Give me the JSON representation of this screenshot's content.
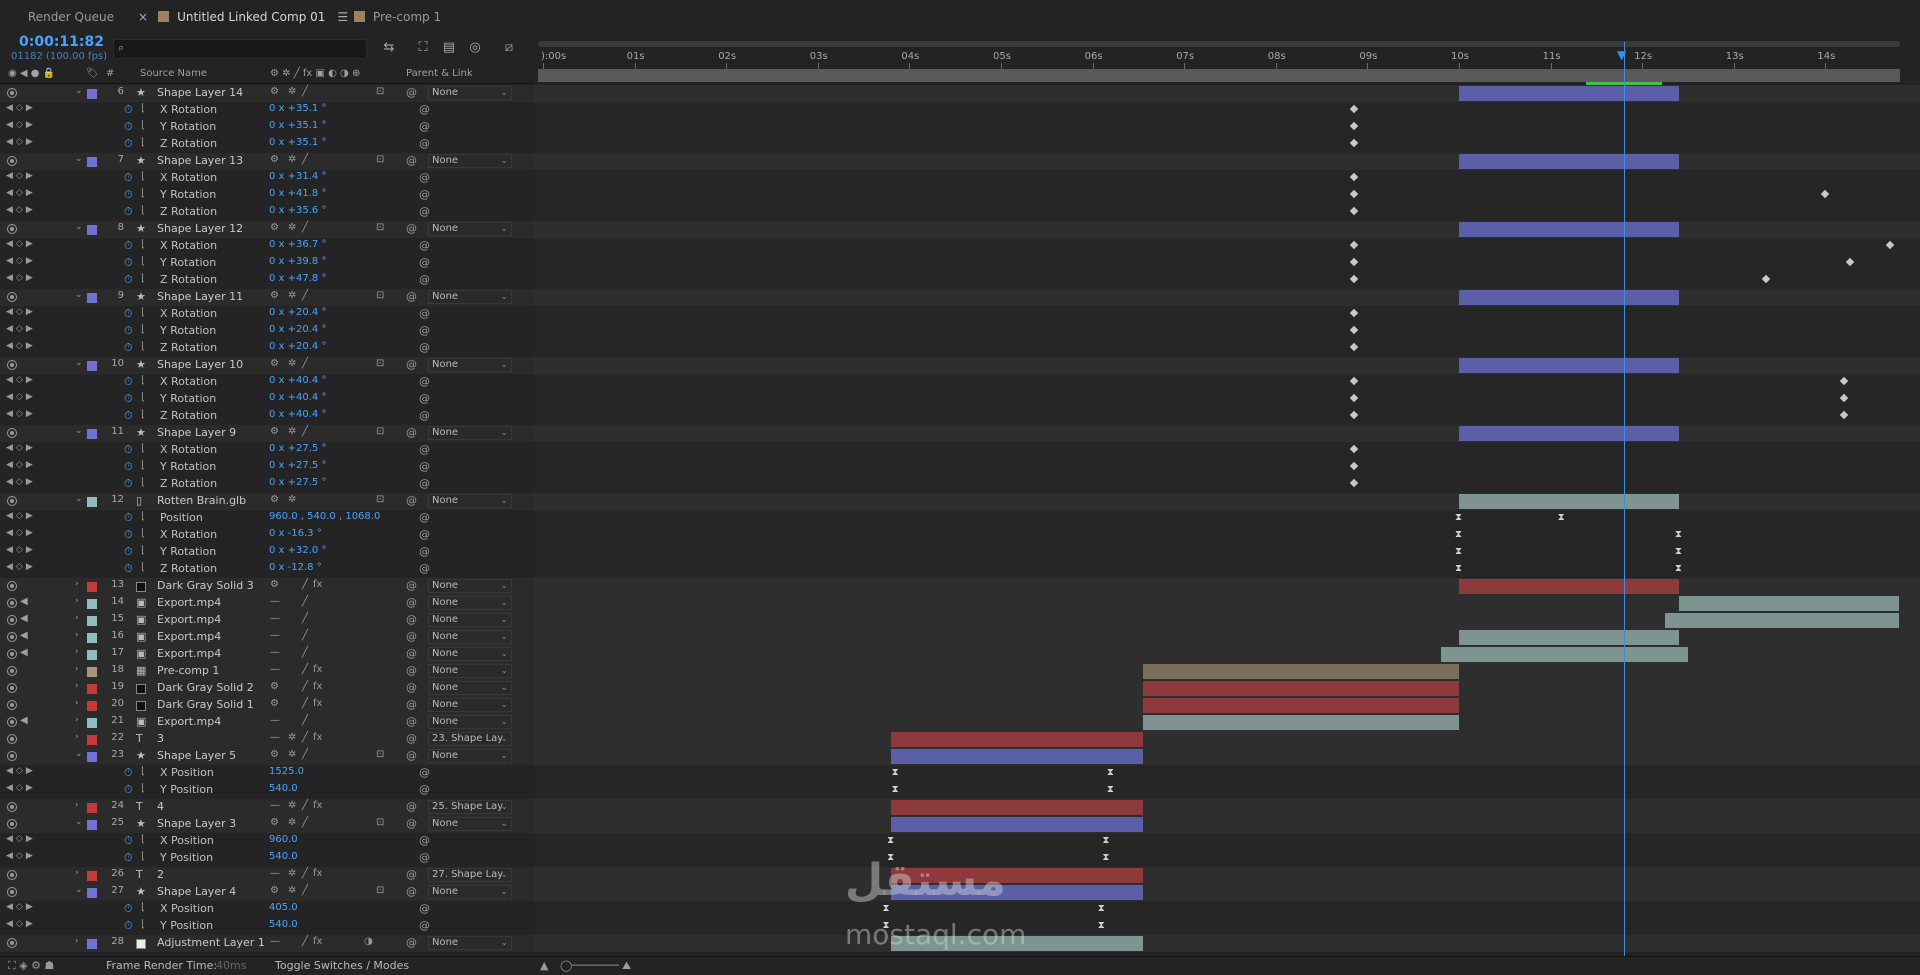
{
  "tabs": [
    {
      "label": "Render Queue",
      "swatch": ""
    },
    {
      "label": "Untitled Linked Comp 01",
      "swatch": "#a08060"
    },
    {
      "label": "Pre-comp 1",
      "swatch": "#a08060"
    }
  ],
  "timecode": "0:00:11:82",
  "fps_line": "01182 (100.00 fps)",
  "search": {
    "placeholder": ""
  },
  "headers": {
    "number": "#",
    "source": "Source Name",
    "parent": "Parent & Link"
  },
  "ruler_ticks": [
    "):00s",
    "01s",
    "02s",
    "03s",
    "04s",
    "05s",
    "06s",
    "07s",
    "08s",
    "09s",
    "10s",
    "11s",
    "12s",
    "13s",
    "14s"
  ],
  "colors": {
    "playhead": "#3b8ee8",
    "label_lavender": "#6f73d4",
    "label_seafoam": "#8fbcbc",
    "label_red": "#c43a3a",
    "label_sandstone": "#a8957a",
    "bar_lavender": "#5a5fa8",
    "bar_seafoam": "#7e9490",
    "bar_red": "#8e3a3d",
    "bar_sand": "#7a6f5c"
  },
  "status": {
    "frame_render_label": "Frame Render Time:",
    "frame_render_value": "40ms",
    "toggle_label": "Toggle Switches / Modes"
  },
  "watermark": {
    "arabic": "مستقل",
    "latin": "mostaql.com"
  },
  "rows": [
    {
      "kind": "layer",
      "num": "6",
      "type": "star",
      "name": "Shape Layer 14",
      "label": "lavender",
      "parent": "None"
    },
    {
      "kind": "prop",
      "name": "X Rotation",
      "value": "0 x +35.1 °"
    },
    {
      "kind": "prop",
      "name": "Y Rotation",
      "value": "0 x +35.1 °"
    },
    {
      "kind": "prop",
      "name": "Z Rotation",
      "value": "0 x +35.1 °"
    },
    {
      "kind": "layer",
      "num": "7",
      "type": "star",
      "name": "Shape Layer 13",
      "label": "lavender",
      "parent": "None"
    },
    {
      "kind": "prop",
      "name": "X Rotation",
      "value": "0 x +31.4 °"
    },
    {
      "kind": "prop",
      "name": "Y Rotation",
      "value": "0 x +41.8 °"
    },
    {
      "kind": "prop",
      "name": "Z Rotation",
      "value": "0 x +35.6 °"
    },
    {
      "kind": "layer",
      "num": "8",
      "type": "star",
      "name": "Shape Layer 12",
      "label": "lavender",
      "parent": "None"
    },
    {
      "kind": "prop",
      "name": "X Rotation",
      "value": "0 x +36.7 °"
    },
    {
      "kind": "prop",
      "name": "Y Rotation",
      "value": "0 x +39.8 °"
    },
    {
      "kind": "prop",
      "name": "Z Rotation",
      "value": "0 x +47.8 °"
    },
    {
      "kind": "layer",
      "num": "9",
      "type": "star",
      "name": "Shape Layer 11",
      "label": "lavender",
      "parent": "None"
    },
    {
      "kind": "prop",
      "name": "X Rotation",
      "value": "0 x +20.4 °"
    },
    {
      "kind": "prop",
      "name": "Y Rotation",
      "value": "0 x +20.4 °"
    },
    {
      "kind": "prop",
      "name": "Z Rotation",
      "value": "0 x +20.4 °"
    },
    {
      "kind": "layer",
      "num": "10",
      "type": "star",
      "name": "Shape Layer 10",
      "label": "lavender",
      "parent": "None"
    },
    {
      "kind": "prop",
      "name": "X Rotation",
      "value": "0 x +40.4 °"
    },
    {
      "kind": "prop",
      "name": "Y Rotation",
      "value": "0 x +40.4 °"
    },
    {
      "kind": "prop",
      "name": "Z Rotation",
      "value": "0 x +40.4 °"
    },
    {
      "kind": "layer",
      "num": "11",
      "type": "star",
      "name": "Shape Layer 9",
      "label": "lavender",
      "parent": "None"
    },
    {
      "kind": "prop",
      "name": "X Rotation",
      "value": "0 x +27.5 °"
    },
    {
      "kind": "prop",
      "name": "Y Rotation",
      "value": "0 x +27.5 °"
    },
    {
      "kind": "prop",
      "name": "Z Rotation",
      "value": "0 x +27.5 °"
    },
    {
      "kind": "layer",
      "num": "12",
      "type": "file",
      "name": "Rotten Brain.glb",
      "label": "seafoam",
      "parent": "None"
    },
    {
      "kind": "prop",
      "name": "Position",
      "value": "960.0 , 540.0 , 1068.0"
    },
    {
      "kind": "prop",
      "name": "X Rotation",
      "value": "0 x -16.3 °"
    },
    {
      "kind": "prop",
      "name": "Y Rotation",
      "value": "0 x +32.0 °"
    },
    {
      "kind": "prop",
      "name": "Z Rotation",
      "value": "0 x -12.8 °"
    },
    {
      "kind": "layer",
      "num": "13",
      "type": "solid",
      "name": "Dark Gray Solid 3",
      "label": "red",
      "parent": "None"
    },
    {
      "kind": "layer",
      "num": "14",
      "type": "video",
      "name": "Export.mp4",
      "label": "seafoam",
      "parent": "None"
    },
    {
      "kind": "layer",
      "num": "15",
      "type": "video",
      "name": "Export.mp4",
      "label": "seafoam",
      "parent": "None"
    },
    {
      "kind": "layer",
      "num": "16",
      "type": "video",
      "name": "Export.mp4",
      "label": "seafoam",
      "parent": "None"
    },
    {
      "kind": "layer",
      "num": "17",
      "type": "video",
      "name": "Export.mp4",
      "label": "seafoam",
      "parent": "None"
    },
    {
      "kind": "layer",
      "num": "18",
      "type": "comp",
      "name": "Pre-comp 1",
      "label": "sandstone",
      "parent": "None"
    },
    {
      "kind": "layer",
      "num": "19",
      "type": "solid",
      "name": "Dark Gray Solid 2",
      "label": "red",
      "parent": "None"
    },
    {
      "kind": "layer",
      "num": "20",
      "type": "solid",
      "name": "Dark Gray Solid 1",
      "label": "red",
      "parent": "None"
    },
    {
      "kind": "layer",
      "num": "21",
      "type": "video",
      "name": "Export.mp4",
      "label": "seafoam",
      "parent": "None"
    },
    {
      "kind": "layer",
      "num": "22",
      "type": "text",
      "name": "3",
      "label": "red",
      "parent": "23. Shape Lay"
    },
    {
      "kind": "layer",
      "num": "23",
      "type": "star",
      "name": "Shape Layer 5",
      "label": "lavender",
      "parent": "None"
    },
    {
      "kind": "prop",
      "name": "X Position",
      "value": "1525.0"
    },
    {
      "kind": "prop",
      "name": "Y Position",
      "value": "540.0"
    },
    {
      "kind": "layer",
      "num": "24",
      "type": "text",
      "name": "4",
      "label": "red",
      "parent": "25. Shape Lay"
    },
    {
      "kind": "layer",
      "num": "25",
      "type": "star",
      "name": "Shape Layer 3",
      "label": "lavender",
      "parent": "None"
    },
    {
      "kind": "prop",
      "name": "X Position",
      "value": "960.0"
    },
    {
      "kind": "prop",
      "name": "Y Position",
      "value": "540.0"
    },
    {
      "kind": "layer",
      "num": "26",
      "type": "text",
      "name": "2",
      "label": "red",
      "parent": "27. Shape Lay"
    },
    {
      "kind": "layer",
      "num": "27",
      "type": "star",
      "name": "Shape Layer 4",
      "label": "lavender",
      "parent": "None"
    },
    {
      "kind": "prop",
      "name": "X Position",
      "value": "405.0"
    },
    {
      "kind": "prop",
      "name": "Y Position",
      "value": "540.0"
    },
    {
      "kind": "layer",
      "num": "28",
      "type": "adj",
      "name": "Adjustment Layer 1",
      "label": "lavender",
      "parent": "None"
    }
  ],
  "timeline_bars": [
    {
      "row": 0,
      "from_s": 10,
      "to_s": 12.4,
      "color": "lavender"
    },
    {
      "row": 4,
      "from_s": 10,
      "to_s": 12.4,
      "color": "lavender"
    },
    {
      "row": 8,
      "from_s": 10,
      "to_s": 12.4,
      "color": "lavender"
    },
    {
      "row": 12,
      "from_s": 10,
      "to_s": 12.4,
      "color": "lavender"
    },
    {
      "row": 16,
      "from_s": 10,
      "to_s": 12.4,
      "color": "lavender"
    },
    {
      "row": 20,
      "from_s": 10,
      "to_s": 12.4,
      "color": "lavender"
    },
    {
      "row": 24,
      "from_s": 10,
      "to_s": 12.4,
      "color": "seafoam"
    },
    {
      "row": 29,
      "from_s": 10,
      "to_s": 12.4,
      "color": "red"
    },
    {
      "row": 30,
      "from_s": 12.4,
      "to_s": 14.8,
      "color": "seafoam"
    },
    {
      "row": 31,
      "from_s": 12.25,
      "to_s": 14.8,
      "color": "seafoam"
    },
    {
      "row": 32,
      "from_s": 10,
      "to_s": 12.4,
      "color": "seafoam"
    },
    {
      "row": 33,
      "from_s": 9.8,
      "to_s": 12.5,
      "color": "seafoam"
    },
    {
      "row": 34,
      "from_s": 6.55,
      "to_s": 10,
      "color": "sand"
    },
    {
      "row": 35,
      "from_s": 6.55,
      "to_s": 10,
      "color": "red"
    },
    {
      "row": 36,
      "from_s": 6.55,
      "to_s": 10,
      "color": "red"
    },
    {
      "row": 37,
      "from_s": 6.55,
      "to_s": 10,
      "color": "seafoam"
    },
    {
      "row": 38,
      "from_s": 3.8,
      "to_s": 6.55,
      "color": "red"
    },
    {
      "row": 39,
      "from_s": 3.8,
      "to_s": 6.55,
      "color": "lavender"
    },
    {
      "row": 42,
      "from_s": 3.8,
      "to_s": 6.55,
      "color": "red"
    },
    {
      "row": 43,
      "from_s": 3.8,
      "to_s": 6.55,
      "color": "lavender"
    },
    {
      "row": 46,
      "from_s": 3.8,
      "to_s": 6.55,
      "color": "red"
    },
    {
      "row": 47,
      "from_s": 3.8,
      "to_s": 6.55,
      "color": "lavender"
    },
    {
      "row": 50,
      "from_s": 3.8,
      "to_s": 6.55,
      "color": "seafoam"
    }
  ],
  "keyframes": [
    {
      "row": 1,
      "t": 8.85,
      "kind": "diamond"
    },
    {
      "row": 2,
      "t": 8.85,
      "kind": "diamond"
    },
    {
      "row": 3,
      "t": 8.85,
      "kind": "diamond"
    },
    {
      "row": 5,
      "t": 8.85,
      "kind": "diamond"
    },
    {
      "row": 6,
      "t": 8.85,
      "kind": "diamond"
    },
    {
      "row": 6,
      "t": 14.0,
      "kind": "diamond"
    },
    {
      "row": 7,
      "t": 8.85,
      "kind": "diamond"
    },
    {
      "row": 9,
      "t": 8.85,
      "kind": "diamond"
    },
    {
      "row": 9,
      "t": 14.7,
      "kind": "diamond"
    },
    {
      "row": 10,
      "t": 8.85,
      "kind": "diamond"
    },
    {
      "row": 10,
      "t": 14.27,
      "kind": "diamond"
    },
    {
      "row": 11,
      "t": 8.85,
      "kind": "diamond"
    },
    {
      "row": 11,
      "t": 13.35,
      "kind": "diamond"
    },
    {
      "row": 13,
      "t": 8.85,
      "kind": "diamond"
    },
    {
      "row": 14,
      "t": 8.85,
      "kind": "diamond"
    },
    {
      "row": 15,
      "t": 8.85,
      "kind": "diamond"
    },
    {
      "row": 17,
      "t": 8.85,
      "kind": "diamond"
    },
    {
      "row": 17,
      "t": 14.2,
      "kind": "diamond"
    },
    {
      "row": 18,
      "t": 8.85,
      "kind": "diamond"
    },
    {
      "row": 18,
      "t": 14.2,
      "kind": "diamond"
    },
    {
      "row": 19,
      "t": 8.85,
      "kind": "diamond"
    },
    {
      "row": 19,
      "t": 14.2,
      "kind": "diamond"
    },
    {
      "row": 21,
      "t": 8.85,
      "kind": "diamond"
    },
    {
      "row": 22,
      "t": 8.85,
      "kind": "diamond"
    },
    {
      "row": 23,
      "t": 8.85,
      "kind": "diamond"
    },
    {
      "row": 25,
      "t": 10.0,
      "kind": "hourglass"
    },
    {
      "row": 25,
      "t": 11.12,
      "kind": "hourglass"
    },
    {
      "row": 26,
      "t": 10.0,
      "kind": "hourglass"
    },
    {
      "row": 26,
      "t": 12.4,
      "kind": "hourglass"
    },
    {
      "row": 27,
      "t": 10.0,
      "kind": "hourglass"
    },
    {
      "row": 27,
      "t": 12.4,
      "kind": "hourglass"
    },
    {
      "row": 28,
      "t": 10.0,
      "kind": "hourglass"
    },
    {
      "row": 28,
      "t": 12.4,
      "kind": "hourglass"
    },
    {
      "row": 40,
      "t": 3.85,
      "kind": "hourglass"
    },
    {
      "row": 40,
      "t": 6.2,
      "kind": "hourglass"
    },
    {
      "row": 41,
      "t": 3.85,
      "kind": "hourglass"
    },
    {
      "row": 41,
      "t": 6.2,
      "kind": "hourglass"
    },
    {
      "row": 44,
      "t": 3.8,
      "kind": "hourglass"
    },
    {
      "row": 44,
      "t": 6.15,
      "kind": "hourglass"
    },
    {
      "row": 45,
      "t": 3.8,
      "kind": "hourglass"
    },
    {
      "row": 45,
      "t": 6.15,
      "kind": "hourglass"
    },
    {
      "row": 48,
      "t": 3.75,
      "kind": "hourglass"
    },
    {
      "row": 48,
      "t": 6.1,
      "kind": "hourglass"
    },
    {
      "row": 49,
      "t": 3.75,
      "kind": "hourglass"
    },
    {
      "row": 49,
      "t": 6.1,
      "kind": "hourglass"
    }
  ]
}
